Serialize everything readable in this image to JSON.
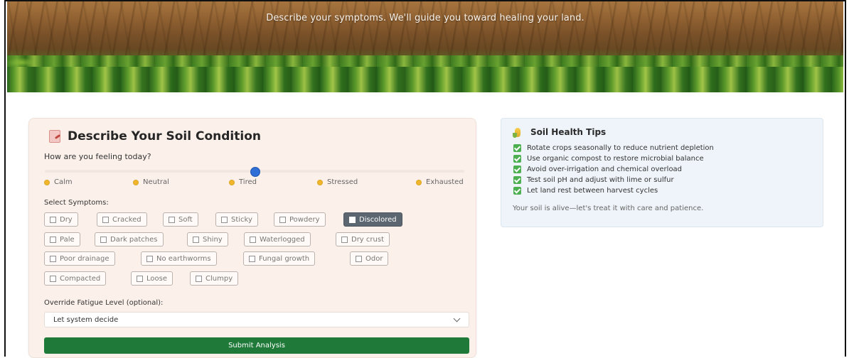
{
  "hero": {
    "subtitle": "Describe your symptoms. We'll guide you toward healing your land."
  },
  "soil_form": {
    "title": "Describe Your Soil Condition",
    "title_icon": "notepad-icon",
    "feeling_question": "How are you feeling today?",
    "feeling_level": 0.5,
    "moods": [
      {
        "label": "Calm",
        "icon": "calm-emoji-icon"
      },
      {
        "label": "Neutral",
        "icon": "neutral-emoji-icon"
      },
      {
        "label": "Tired",
        "icon": "tired-emoji-icon"
      },
      {
        "label": "Stressed",
        "icon": "stressed-emoji-icon"
      },
      {
        "label": "Exhausted",
        "icon": "exhausted-emoji-icon"
      }
    ],
    "symptoms_label": "Select Symptoms:",
    "symptoms": [
      {
        "label": "Dry",
        "selected": false
      },
      {
        "label": "Cracked",
        "selected": false
      },
      {
        "label": "Soft",
        "selected": false
      },
      {
        "label": "Sticky",
        "selected": false
      },
      {
        "label": "Powdery",
        "selected": false
      },
      {
        "label": "Discolored",
        "selected": true
      },
      {
        "label": "Pale",
        "selected": false
      },
      {
        "label": "Dark patches",
        "selected": false
      },
      {
        "label": "Shiny",
        "selected": false
      },
      {
        "label": "Waterlogged",
        "selected": false
      },
      {
        "label": "Dry crust",
        "selected": false
      },
      {
        "label": "Poor drainage",
        "selected": false
      },
      {
        "label": "No earthworms",
        "selected": false
      },
      {
        "label": "Fungal growth",
        "selected": false
      },
      {
        "label": "Odor",
        "selected": false
      },
      {
        "label": "Compacted",
        "selected": false
      },
      {
        "label": "Loose",
        "selected": false
      },
      {
        "label": "Clumpy",
        "selected": false
      }
    ],
    "override_label": "Override Fatigue Level (optional):",
    "override_value": "Let system decide",
    "submit_label": "Submit Analysis",
    "submit_color": "#1f7a3a"
  },
  "tips": {
    "title": "Soil Health Tips",
    "title_icon": "corn-icon",
    "items": [
      "Rotate crops seasonally to reduce nutrient depletion",
      "Use organic compost to restore microbial balance",
      "Avoid over-irrigation and chemical overload",
      "Test soil pH and adjust with lime or sulfur",
      "Let land rest between harvest cycles"
    ],
    "note": "Your soil is alive—let's treat it with care and patience."
  }
}
